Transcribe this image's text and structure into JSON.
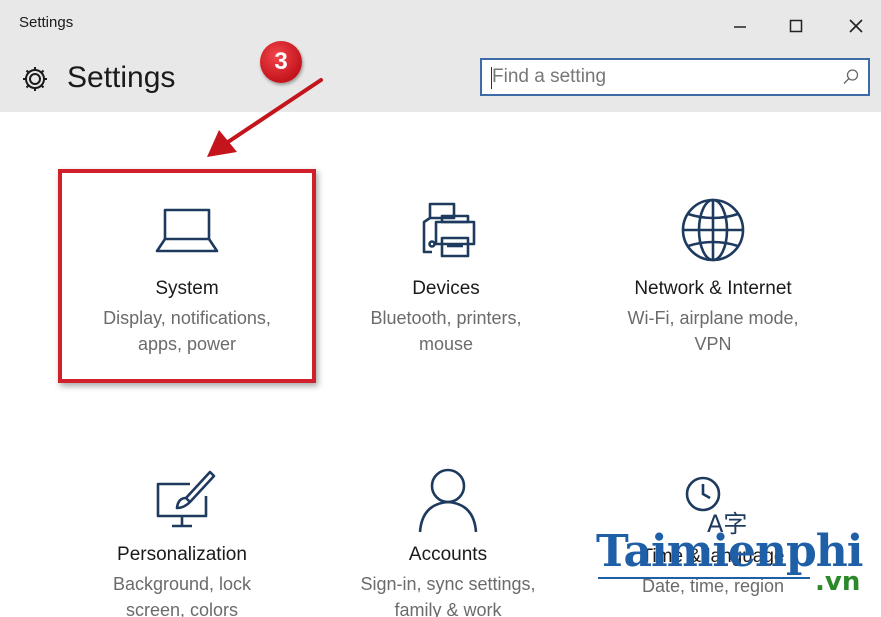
{
  "window": {
    "title": "Settings",
    "minimize_glyph": "–",
    "maximize_glyph": "☐",
    "close_glyph": "✕"
  },
  "header": {
    "title": "Settings",
    "icon": "gear-icon"
  },
  "search": {
    "placeholder": "Find a setting",
    "value": "",
    "icon": "search-icon",
    "border_color": "#3c6ba8"
  },
  "annotation": {
    "step_number": "3",
    "highlight_color": "#d0202a"
  },
  "tiles": [
    {
      "title": "System",
      "desc_line1": "Display, notifications,",
      "desc_line2": "apps, power",
      "icon": "laptop-icon"
    },
    {
      "title": "Devices",
      "desc_line1": "Bluetooth, printers,",
      "desc_line2": "mouse",
      "icon": "devices-printer-icon"
    },
    {
      "title": "Network & Internet",
      "desc_line1": "Wi-Fi, airplane mode,",
      "desc_line2": "VPN",
      "icon": "globe-icon"
    },
    {
      "title": "Personalization",
      "desc_line1": "Background, lock",
      "desc_line2": "screen, colors",
      "icon": "personalization-paintbrush-icon"
    },
    {
      "title": "Accounts",
      "desc_line1": "Sign-in, sync settings,",
      "desc_line2": "family & work",
      "icon": "person-icon"
    },
    {
      "title": "Time & language",
      "desc_line1": "Date, time, region",
      "desc_line2": "",
      "icon": "clock-language-icon"
    }
  ],
  "watermark": {
    "main": "Taimienphi",
    "sub": ".vn"
  },
  "colors": {
    "icon_stroke": "#1e3a5f",
    "accent_blue": "#1f5fa8",
    "titlebar_bg": "#e8e8e8"
  }
}
